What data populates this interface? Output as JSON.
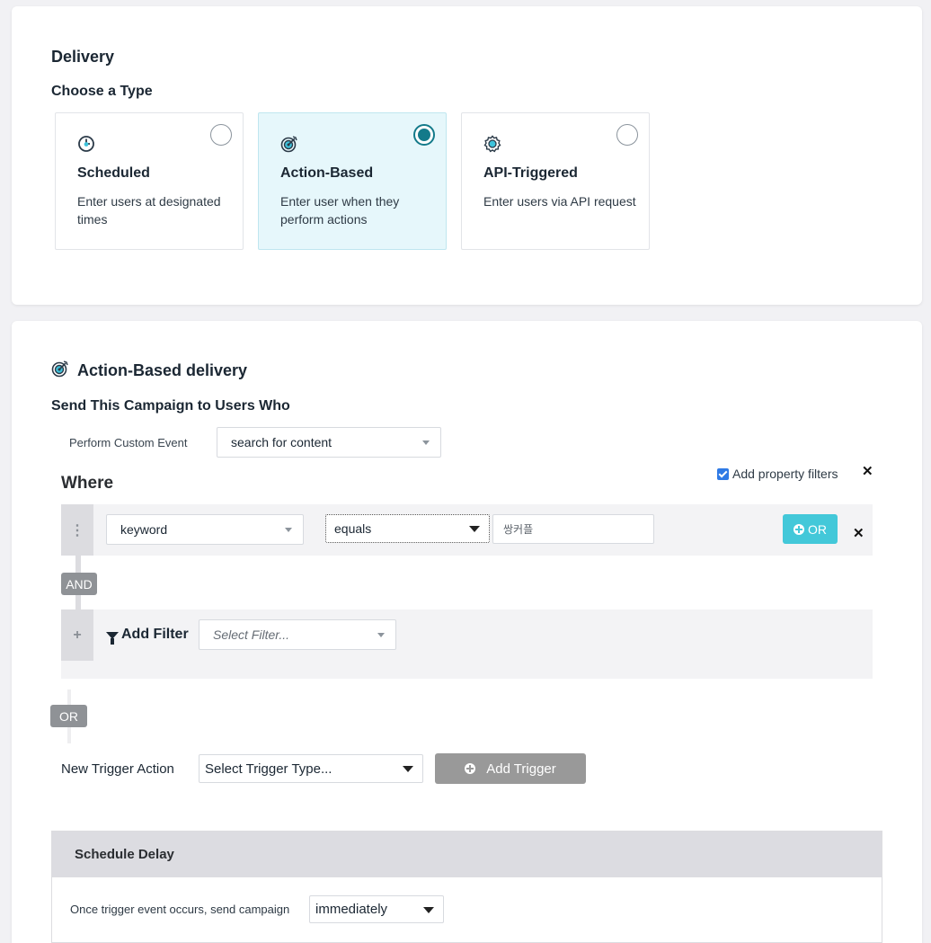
{
  "delivery": {
    "title": "Delivery",
    "subtitle": "Choose a Type",
    "types": [
      {
        "title": "Scheduled",
        "description": "Enter users at designated times",
        "icon": "clock-icon",
        "selected": false
      },
      {
        "title": "Action-Based",
        "description": "Enter user when they perform actions",
        "icon": "target-icon",
        "selected": true
      },
      {
        "title": "API-Triggered",
        "description": "Enter users via API request",
        "icon": "gear-icon",
        "selected": false
      }
    ]
  },
  "action": {
    "title": "Action-Based delivery",
    "subtitle": "Send This Campaign to Users Who",
    "event_label": "Perform Custom Event",
    "event_value": "search for content",
    "add_property_filters_label": "Add property filters",
    "add_property_filters_checked": true,
    "where_label": "Where",
    "filter": {
      "property": "keyword",
      "operator": "equals",
      "value": "쌍커플",
      "or_button": "OR"
    },
    "and_badge": "AND",
    "add_filter_label": "Add Filter",
    "select_filter_placeholder": "Select Filter...",
    "or_badge": "OR",
    "new_trigger_label": "New Trigger Action",
    "trigger_type_placeholder": "Select Trigger Type...",
    "add_trigger_button": "Add Trigger"
  },
  "schedule_delay": {
    "title": "Schedule Delay",
    "label": "Once trigger event occurs, send campaign",
    "value": "immediately"
  },
  "colors": {
    "accent_teal": "#137a8a",
    "or_button": "#43c8d9",
    "selected_card_bg": "#e6f7fb",
    "checkbox": "#2f7ae5"
  }
}
